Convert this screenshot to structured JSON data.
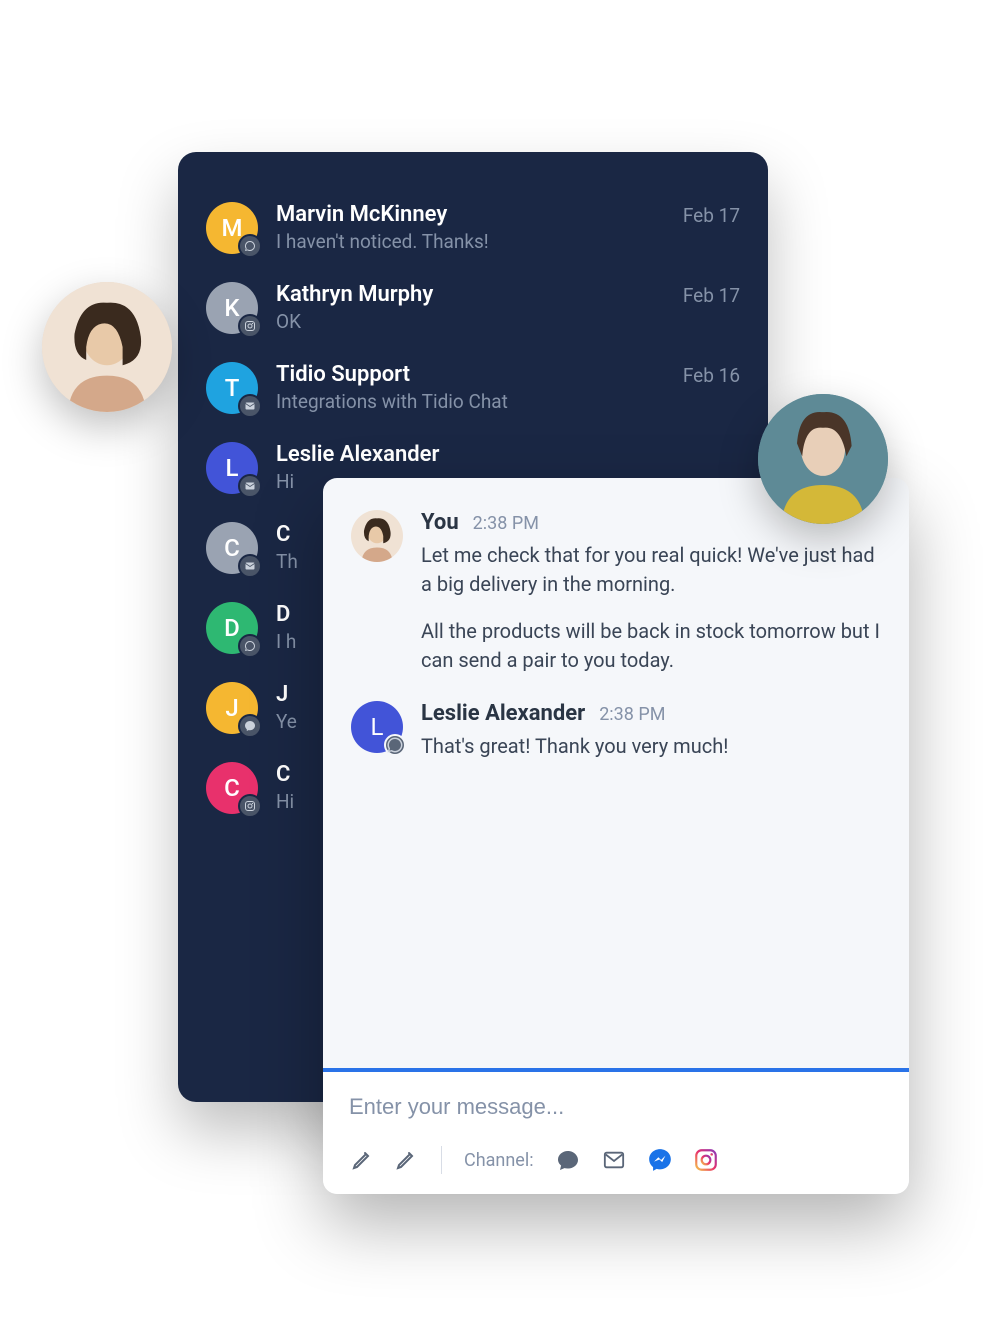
{
  "conversations": [
    {
      "initial": "M",
      "name": "Marvin McKinney",
      "snippet": "I haven't noticed. Thanks!",
      "date": "Feb 17",
      "color": "#f5b731",
      "channel": "whatsapp"
    },
    {
      "initial": "K",
      "name": "Kathryn Murphy",
      "snippet": "OK",
      "date": "Feb 17",
      "color": "#9aa3b2",
      "channel": "instagram"
    },
    {
      "initial": "T",
      "name": "Tidio Support",
      "snippet": "Integrations with Tidio Chat",
      "date": "Feb 16",
      "color": "#1fa3e0",
      "channel": "email"
    },
    {
      "initial": "L",
      "name": "Leslie Alexander",
      "snippet": "Hi",
      "date": "",
      "color": "#4254d8",
      "channel": "email"
    },
    {
      "initial": "C",
      "name": "C",
      "snippet": "Th",
      "date": "",
      "color": "#9aa3b2",
      "channel": "email"
    },
    {
      "initial": "D",
      "name": "D",
      "snippet": "I h",
      "date": "",
      "color": "#2eb872",
      "channel": "whatsapp"
    },
    {
      "initial": "J",
      "name": "J",
      "snippet": "Ye",
      "date": "",
      "color": "#f5b731",
      "channel": "messenger"
    },
    {
      "initial": "C",
      "name": "C",
      "snippet": "Hi",
      "date": "",
      "color": "#e8316c",
      "channel": "instagram"
    }
  ],
  "chat": {
    "messages": [
      {
        "sender_label": "You",
        "time": "2:38 PM",
        "avatar_type": "photo",
        "paragraphs": [
          "Let me check that for you real quick! We've just had a big delivery in the morning.",
          "All the products will be back in stock tomorrow but I can send a pair to you today."
        ]
      },
      {
        "sender_label": "Leslie Alexander",
        "time": "2:38 PM",
        "avatar_type": "letter",
        "avatar_initial": "L",
        "paragraphs": [
          "That's great! Thank you very much!"
        ]
      }
    ],
    "input_placeholder": "Enter your message...",
    "channel_label": "Channel:"
  }
}
